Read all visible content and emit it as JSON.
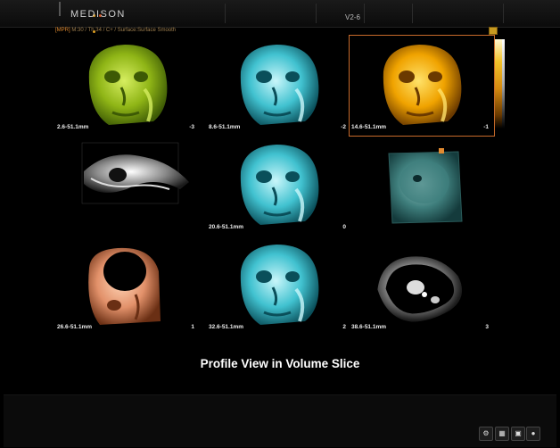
{
  "header": {
    "brand": "MEDISON",
    "probe": "V2-6"
  },
  "infoline": {
    "mode": "[MPR]",
    "params": "M:30 / Th 34 / C+ / Surface:Surface Smooth"
  },
  "tiles": [
    {
      "range": "2.6-51.1mm",
      "index": "-3",
      "colormap": "green"
    },
    {
      "range": "8.6-51.1mm",
      "index": "-2",
      "colormap": "cyan"
    },
    {
      "range": "14.6-51.1mm",
      "index": "-1",
      "colormap": "gold",
      "selected": true
    },
    {
      "range": "",
      "index": "",
      "colormap": "grayscale-slice"
    },
    {
      "range": "20.6-51.1mm",
      "index": "0",
      "colormap": "cyan"
    },
    {
      "range": "",
      "index": "",
      "colormap": "teal-volume"
    },
    {
      "range": "26.6-51.1mm",
      "index": "1",
      "colormap": "copper"
    },
    {
      "range": "32.6-51.1mm",
      "index": "2",
      "colormap": "cyan"
    },
    {
      "range": "38.6-51.1mm",
      "index": "3",
      "colormap": "grayscale"
    }
  ],
  "caption": "Profile View in Volume Slice",
  "colors": {
    "accent": "#e08a30",
    "green": "#9cc21a",
    "cyan": "#3cc3cf",
    "gold": "#f0a800",
    "copper": "#e59a6a"
  },
  "bottom_icons": [
    "settings-icon",
    "grid-icon",
    "monitor-icon",
    "lock-icon"
  ]
}
